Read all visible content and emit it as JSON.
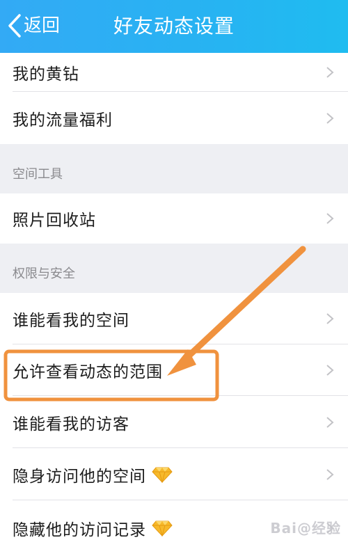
{
  "header": {
    "back_label": "返回",
    "title": "好友动态设置"
  },
  "rows": {
    "yellow_diamond": "我的黄钻",
    "traffic_benefit": "我的流量福利",
    "section_tools": "空间工具",
    "photo_recycle": "照片回收站",
    "section_privacy": "权限与安全",
    "who_can_see_space": "谁能看我的空间",
    "allow_view_scope": "允许查看动态的范围",
    "who_can_see_visitors": "谁能看我的访客",
    "invisible_visit": "隐身访问他的空间",
    "hide_visit_record": "隐藏他的访问记录"
  },
  "colors": {
    "header": "#2db0f4",
    "annotation": "#f0923e",
    "gem": "#f7b92b"
  },
  "icons": {
    "back": "chevron-left-icon",
    "row": "chevron-right-icon",
    "premium": "diamond-icon"
  },
  "watermark": "Bai@经验"
}
